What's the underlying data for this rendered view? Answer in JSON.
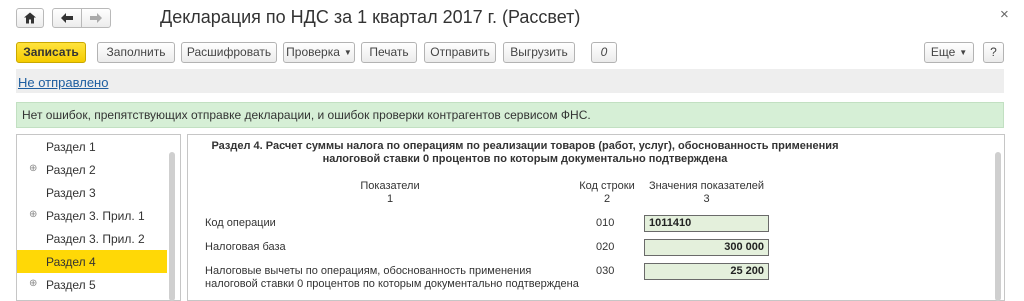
{
  "window": {
    "title": "Декларация по НДС за 1 квартал 2017 г. (Рассвет)",
    "close_glyph": "×"
  },
  "toolbar": {
    "save": "Записать",
    "fill": "Заполнить",
    "decode": "Расшифровать",
    "check": "Проверка",
    "print": "Печать",
    "send": "Отправить",
    "export": "Выгрузить",
    "attach_glyph": "0",
    "more": "Еще",
    "help": "?"
  },
  "status": {
    "link": "Не отправлено"
  },
  "info": {
    "message": "Нет ошибок, препятствующих отправке декларации, и ошибок проверки контрагентов сервисом ФНС."
  },
  "sections": {
    "items": [
      {
        "label": "Раздел 1",
        "expandable": false
      },
      {
        "label": "Раздел 2",
        "expandable": true
      },
      {
        "label": "Раздел 3",
        "expandable": false
      },
      {
        "label": "Раздел 3. Прил. 1",
        "expandable": true
      },
      {
        "label": "Раздел 3. Прил. 2",
        "expandable": false
      },
      {
        "label": "Раздел 4",
        "expandable": false,
        "active": true
      },
      {
        "label": "Раздел 5",
        "expandable": true
      }
    ],
    "expand_glyph": "⊕"
  },
  "form": {
    "section_title": "Раздел 4. Расчет суммы налога по операциям по реализации товаров (работ, услуг), обоснованность применения налоговой ставки 0 процентов по которым документально подтверждена",
    "headers": {
      "indicators": "Показатели",
      "indicators_num": "1",
      "line_code": "Код строки",
      "line_code_num": "2",
      "values": "Значения показателей",
      "values_num": "3"
    },
    "rows": [
      {
        "label": "Код операции",
        "code": "010",
        "value": "1011410"
      },
      {
        "label": "Налоговая база",
        "code": "020",
        "value": "300 000"
      },
      {
        "label": "Налоговые вычеты по операциям, обоснованность применения налоговой ставки 0 процентов по которым документально подтверждена",
        "code": "030",
        "value": "25 200"
      }
    ]
  },
  "colors": {
    "primary_button": "#f5cc00",
    "info_bar": "#d6efd6",
    "active_item": "#ffd806",
    "value_box": "#e4f0dc",
    "link": "#1e5ea0"
  }
}
